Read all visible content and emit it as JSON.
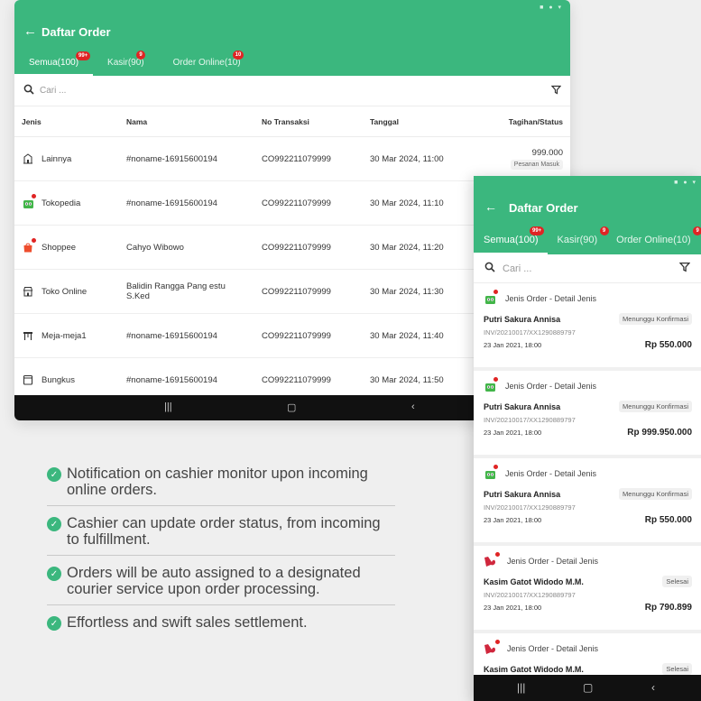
{
  "tablet": {
    "title": "Daftar Order",
    "tabs": [
      {
        "label": "Semua(100)",
        "badge": "99+"
      },
      {
        "label": "Kasir(90)",
        "badge": "9"
      },
      {
        "label": "Order Online(10)",
        "badge": "10"
      }
    ],
    "search_placeholder": "Cari ...",
    "columns": [
      "Jenis",
      "Nama",
      "No Transaksi",
      "Tanggal",
      "Tagihan/Status"
    ],
    "rows": [
      {
        "jenis": "Lainnya",
        "icon": "building-icon",
        "nama": "#noname-16915600194",
        "no": "CO992211079999",
        "tanggal": "30 Mar 2024, 11:00",
        "tagihan": "999.000",
        "status": "Pesanan Masuk"
      },
      {
        "jenis": "Tokopedia",
        "icon": "tokopedia-icon",
        "nama": "#noname-16915600194",
        "no": "CO992211079999",
        "tanggal": "30 Mar 2024, 11:10",
        "tagihan": "",
        "status": ""
      },
      {
        "jenis": "Shoppee",
        "icon": "shopee-icon",
        "nama": "Cahyo Wibowo",
        "no": "CO992211079999",
        "tanggal": "30 Mar 2024, 11:20",
        "tagihan": "",
        "status": ""
      },
      {
        "jenis": "Toko Online",
        "icon": "store-icon",
        "nama": "Balidin Rangga Pang estu S.Ked",
        "no": "CO992211079999",
        "tanggal": "30 Mar 2024, 11:30",
        "tagihan": "",
        "status": ""
      },
      {
        "jenis": "Meja-meja1",
        "icon": "table-icon",
        "nama": "#noname-16915600194",
        "no": "CO992211079999",
        "tanggal": "30 Mar 2024, 11:40",
        "tagihan": "",
        "status": ""
      },
      {
        "jenis": "Bungkus",
        "icon": "package-icon",
        "nama": "#noname-16915600194",
        "no": "CO992211079999",
        "tanggal": "30 Mar 2024, 11:50",
        "tagihan": "",
        "status": ""
      }
    ]
  },
  "bullets": [
    "Notification on cashier monitor upon incoming online orders.",
    "Cashier can update order status, from incoming to fulfillment.",
    "Orders will be auto assigned to a designated courier service upon order processing.",
    "Effortless and swift sales settlement."
  ],
  "phone": {
    "title": "Daftar Order",
    "tabs": [
      {
        "label": "Semua(100)",
        "badge": "99+"
      },
      {
        "label": "Kasir(90)",
        "badge": "9"
      },
      {
        "label": "Order Online(10)",
        "badge": "9"
      }
    ],
    "search_placeholder": "Cari ...",
    "cards": [
      {
        "icon": "tokopedia-icon",
        "jenis": "Jenis Order - Detail Jenis",
        "name": "Putri Sakura Annisa",
        "status": "Menunggu Konfirmasi",
        "inv": "INV/20210017/XX1290889797",
        "date": "23 Jan 2021, 18:00",
        "amount": "Rp 550.000"
      },
      {
        "icon": "tokopedia-icon",
        "jenis": "Jenis Order - Detail Jenis",
        "name": "Putri Sakura Annisa",
        "status": "Menunggu Konfirmasi",
        "inv": "INV/20210017/XX1290889797",
        "date": "23 Jan 2021, 18:00",
        "amount": "Rp 999.950.000"
      },
      {
        "icon": "tokopedia-icon",
        "jenis": "Jenis Order - Detail Jenis",
        "name": "Putri Sakura Annisa",
        "status": "Menunggu Konfirmasi",
        "inv": "INV/20210017/XX1290889797",
        "date": "23 Jan 2021, 18:00",
        "amount": "Rp 550.000"
      },
      {
        "icon": "b-logo-icon",
        "jenis": "Jenis Order - Detail Jenis",
        "name": "Kasim Gatot Widodo M.M.",
        "status": "Selesai",
        "inv": "INV/20210017/XX1290889797",
        "date": "23 Jan 2021, 18:00",
        "amount": "Rp 790.899"
      },
      {
        "icon": "b-logo-icon",
        "jenis": "Jenis Order - Detail Jenis",
        "name": "Kasim Gatot Widodo M.M.",
        "status": "Selesai",
        "inv": "",
        "date": "",
        "amount": ""
      }
    ]
  }
}
